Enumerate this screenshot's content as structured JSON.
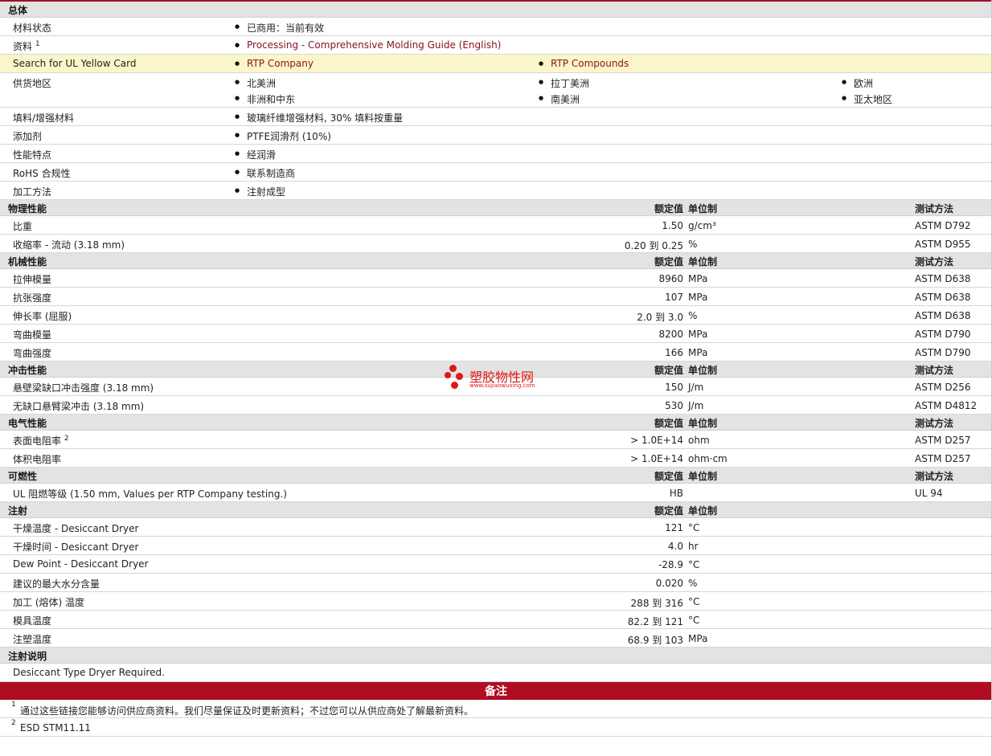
{
  "general": {
    "title": "总体",
    "rows": [
      {
        "label": "材料状态",
        "items": [
          "已商用：当前有效"
        ]
      },
      {
        "label": "资料",
        "sup": "1",
        "items": [
          "Processing - Comprehensive Molding Guide (English)"
        ]
      },
      {
        "label": "Search for UL Yellow Card",
        "items": [
          "RTP Company",
          "RTP Compounds"
        ]
      },
      {
        "label": "供货地区",
        "items": [
          "北美洲",
          "拉丁美洲",
          "欧洲",
          "非洲和中东",
          "南美洲",
          "亚太地区"
        ]
      },
      {
        "label": "填料/增强材料",
        "items": [
          "玻璃纤维增强材料, 30% 填料按重量"
        ]
      },
      {
        "label": "添加剂",
        "items": [
          "PTFE润滑剂 (10%)"
        ]
      },
      {
        "label": "性能特点",
        "items": [
          "经润滑"
        ]
      },
      {
        "label": "RoHS 合规性",
        "items": [
          "联系制造商"
        ]
      },
      {
        "label": "加工方法",
        "items": [
          "注射成型"
        ]
      }
    ]
  },
  "headers": {
    "value": "额定值",
    "unit": "单位制",
    "test": "测试方法"
  },
  "physical": {
    "title": "物理性能",
    "rows": [
      {
        "label": "比重",
        "value": "1.50",
        "unit": "g/cm³",
        "test": "ASTM D792"
      },
      {
        "label": "收缩率 - 流动 (3.18 mm)",
        "value": "0.20 到 0.25",
        "unit": "%",
        "test": "ASTM D955"
      }
    ]
  },
  "mechanical": {
    "title": "机械性能",
    "rows": [
      {
        "label": "拉伸模量",
        "value": "8960",
        "unit": "MPa",
        "test": "ASTM D638"
      },
      {
        "label": "抗张强度",
        "value": "107",
        "unit": "MPa",
        "test": "ASTM D638"
      },
      {
        "label": "伸长率 (屈服)",
        "value": "2.0 到 3.0",
        "unit": "%",
        "test": "ASTM D638"
      },
      {
        "label": "弯曲模量",
        "value": "8200",
        "unit": "MPa",
        "test": "ASTM D790"
      },
      {
        "label": "弯曲强度",
        "value": "166",
        "unit": "MPa",
        "test": "ASTM D790"
      }
    ]
  },
  "impact": {
    "title": "冲击性能",
    "rows": [
      {
        "label": "悬壁梁缺口冲击强度 (3.18 mm)",
        "value": "150",
        "unit": "J/m",
        "test": "ASTM D256"
      },
      {
        "label": "无缺口悬臂梁冲击 (3.18 mm)",
        "value": "530",
        "unit": "J/m",
        "test": "ASTM D4812"
      }
    ]
  },
  "electrical": {
    "title": "电气性能",
    "rows": [
      {
        "label": "表面电阻率",
        "sup": "2",
        "value": "> 1.0E+14",
        "unit": "ohm",
        "test": "ASTM D257"
      },
      {
        "label": "体积电阻率",
        "value": "> 1.0E+14",
        "unit": "ohm·cm",
        "test": "ASTM D257"
      }
    ]
  },
  "flammability": {
    "title": "可燃性",
    "rows": [
      {
        "label": "UL 阻燃等级 (1.50 mm, Values per RTP Company testing.)",
        "value": "HB",
        "unit": "",
        "test": "UL 94"
      }
    ]
  },
  "injection": {
    "title": "注射",
    "rows": [
      {
        "label": "干燥温度 - Desiccant Dryer",
        "value": "121",
        "unit": "°C"
      },
      {
        "label": "干燥时间 - Desiccant Dryer",
        "value": "4.0",
        "unit": "hr"
      },
      {
        "label": "Dew Point - Desiccant Dryer",
        "value": "-28.9",
        "unit": "°C"
      },
      {
        "label": "建议的最大水分含量",
        "value": "0.020",
        "unit": "%"
      },
      {
        "label": "加工 (熔体) 温度",
        "value": "288 到 316",
        "unit": "°C"
      },
      {
        "label": "模具温度",
        "value": "82.2 到 121",
        "unit": "°C"
      },
      {
        "label": "注塑温度",
        "value": "68.9 到 103",
        "unit": "MPa"
      }
    ]
  },
  "injection_notes": {
    "title": "注射说明",
    "text": "Desiccant Type Dryer Required."
  },
  "notes": {
    "title": "备注",
    "items": [
      {
        "num": "1",
        "text": "通过这些链接您能够访问供应商资料。我们尽量保证及时更新资料；不过您可以从供应商处了解最新资料。"
      },
      {
        "num": "2",
        "text": "ESD STM11.11"
      }
    ]
  },
  "watermark": {
    "title": "塑胶物性网",
    "url": "www.sujiaowuxing.com",
    "color": "#e01818"
  },
  "colors": {
    "accent": "#b10d22",
    "link": "#8a1326",
    "highlight": "#fbf6c9",
    "section": "#e3e3e3"
  }
}
